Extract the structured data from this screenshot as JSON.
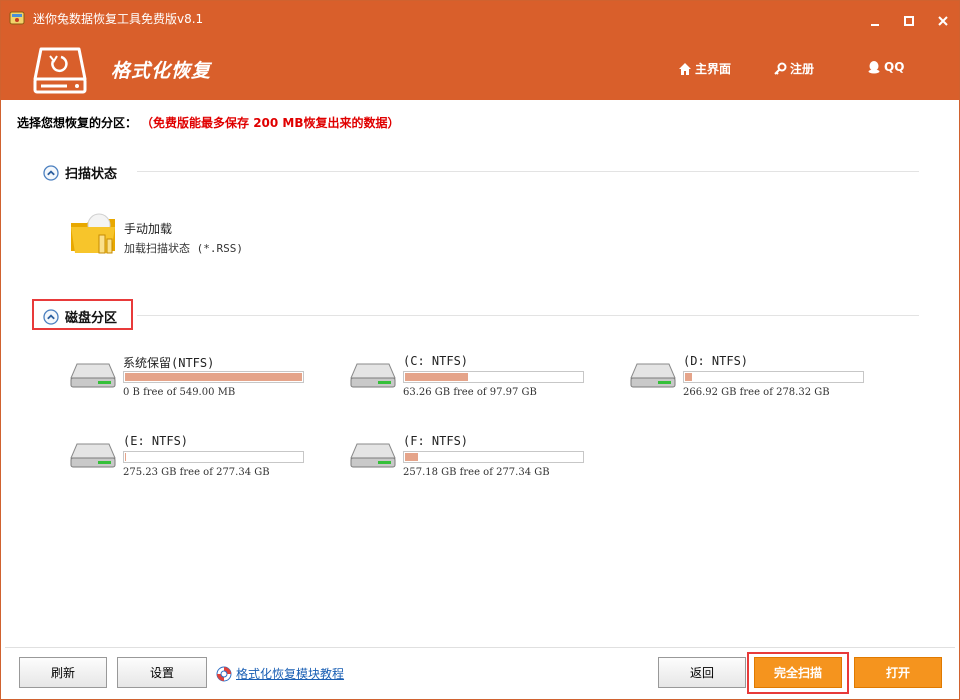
{
  "window": {
    "title": "迷你兔数据恢复工具免费版v8.1"
  },
  "header": {
    "module_title": "格式化恢复",
    "nav": {
      "home": "主界面",
      "register": "注册",
      "qq": "QQ"
    }
  },
  "prompt": {
    "label": "选择您想恢复的分区：",
    "warning": "（免费版能最多保存 200 MB恢复出来的数据）"
  },
  "scan_state": {
    "heading": "扫描状态",
    "manual_load": {
      "name": "手动加载",
      "desc": "加载扫描状态 (*.RSS)"
    }
  },
  "disk_partitions": {
    "heading": "磁盘分区",
    "drives": [
      {
        "name": "系统保留(NTFS)",
        "free_text": "0 B free of 549.00 MB",
        "used_fraction": 1.0
      },
      {
        "name": "(C: NTFS)",
        "free_text": "63.26 GB free of 97.97 GB",
        "used_fraction": 0.354
      },
      {
        "name": "(D: NTFS)",
        "free_text": "266.92 GB free of 278.32 GB",
        "used_fraction": 0.041
      },
      {
        "name": "(E: NTFS)",
        "free_text": "275.23 GB free of 277.34 GB",
        "used_fraction": 0.008
      },
      {
        "name": "(F: NTFS)",
        "free_text": "257.18 GB free of 277.34 GB",
        "used_fraction": 0.073
      }
    ]
  },
  "footer": {
    "refresh": "刷新",
    "settings": "设置",
    "tutorial": "格式化恢复模块教程",
    "back": "返回",
    "full_scan": "完全扫描",
    "open": "打开"
  },
  "colors": {
    "header_bg": "#d95f2b",
    "accent_button": "#f5941e",
    "warning_text": "#e00000",
    "highlight_box": "#e83a3a",
    "usage_fill": "#e5a48a"
  }
}
